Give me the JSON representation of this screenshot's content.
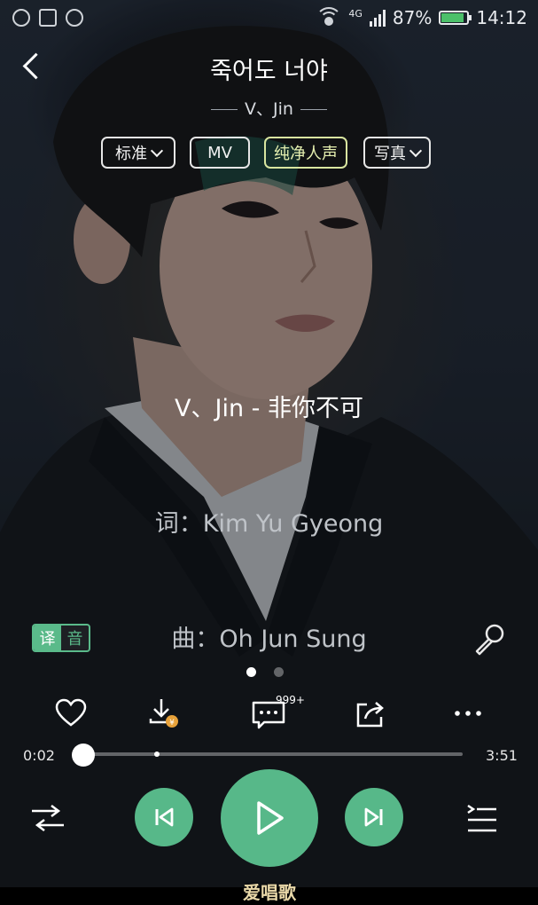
{
  "status_bar": {
    "network": "4G",
    "battery": "87%",
    "battery_level": 0.87,
    "time": "14:12",
    "icons": [
      "hotspot-icon",
      "image-icon",
      "no-disturb-icon",
      "wifi-icon",
      "signal-icon",
      "battery-icon"
    ]
  },
  "header": {
    "title": "죽어도 너야",
    "artist": "V、Jin"
  },
  "chips": {
    "quality": "标准",
    "mv": "MV",
    "pure_vocal": "纯净人声",
    "photo": "写真"
  },
  "lyrics": {
    "current": "V、Jin - 非你不可",
    "line2": "词：Kim Yu Gyeong",
    "line3": "曲：Oh Jun Sung"
  },
  "translate_tag": {
    "on": "译",
    "off": "音"
  },
  "comments": {
    "count": "999+"
  },
  "progress": {
    "elapsed": "0:02",
    "total": "3:51",
    "fraction": 0.01
  },
  "watermark": "爱唱歌",
  "colors": {
    "accent": "#57b889",
    "chip_active": "#d9e6a0"
  }
}
